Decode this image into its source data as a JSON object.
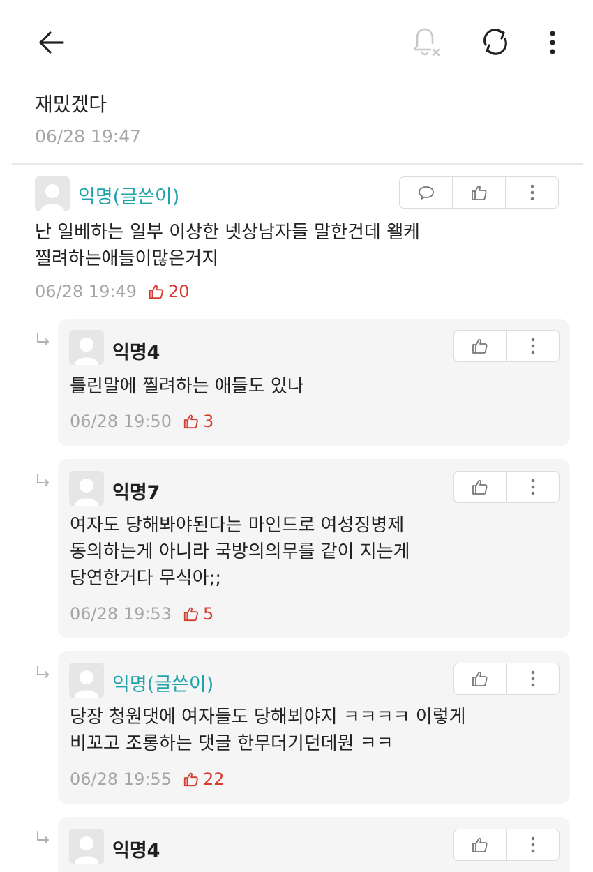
{
  "post": {
    "body": "재밌겠다",
    "time": "06/28 19:47"
  },
  "comment": {
    "author": "익명(글쓴이)",
    "text": "난 일베하는 일부 이상한 넷상남자들 말한건데 왤케\n찔려하는애들이많은거지",
    "time": "06/28 19:49",
    "likes": "20"
  },
  "replies": [
    {
      "author": "익명4",
      "text": "틀린말에 찔려하는 애들도 있나",
      "time": "06/28 19:50",
      "likes": "3"
    },
    {
      "author": "익명7",
      "text": "여자도 당해봐야된다는 마인드로 여성징병제\n동의하는게 아니라 국방의의무를 같이 지는게\n당연한거다 무식아;;",
      "time": "06/28 19:53",
      "likes": "5"
    },
    {
      "author": "익명(글쓴이)",
      "text": "당장 청원댓에 여자들도 당해뵈야지 ㅋㅋㅋㅋ 이렇게\n비꼬고 조롱하는 댓글 한무더기던데뭔 ㅋㅋ",
      "time": "06/28 19:55",
      "likes": "22"
    },
    {
      "author": "익명4"
    }
  ],
  "icons": {
    "back": "arrow-left-icon",
    "notify": "bell-off-icon",
    "refresh": "refresh-icon",
    "more": "more-vertical-icon",
    "reply": "speech-bubble-icon",
    "like": "thumbs-up-icon",
    "reply_indicator": "reply-arrow-icon"
  },
  "colors": {
    "op_author": "#1fa3a8",
    "likes": "#d33c2f",
    "muted": "#a6a6a6"
  }
}
